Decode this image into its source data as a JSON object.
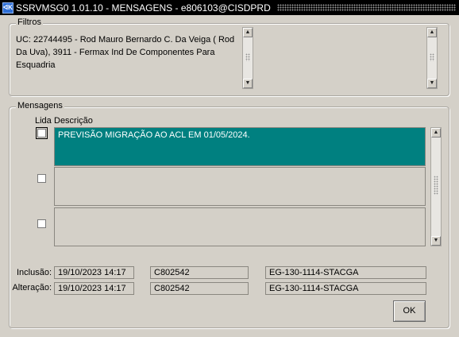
{
  "window": {
    "title": "SSRVMSG0 1.01.10 - MENSAGENS  - e806103@CISDPRD",
    "icon_name": "oracle-forms-icon",
    "icon_glyph": "ᐊK"
  },
  "filters": {
    "legend": "Filtros",
    "text": "UC: 22744495 - Rod Mauro Bernardo C. Da Veiga ( Rod Da Uva), 3911 - Fermax Ind De Componentes Para Esquadria"
  },
  "messages": {
    "legend": "Mensagens",
    "col_read": "Lida",
    "col_description": "Descrição",
    "rows": [
      {
        "read": false,
        "description": "PREVISÃO MIGRAÇÃO AO ACL EM 01/05/2024."
      },
      {
        "read": false,
        "description": ""
      },
      {
        "read": false,
        "description": ""
      }
    ]
  },
  "audit": {
    "inclusion_label": "Inclusão:",
    "inclusion_date": "19/10/2023 14:17",
    "inclusion_user": "C802542",
    "inclusion_host": "EG-130-1114-STACGA",
    "change_label": "Alteração:",
    "change_date": "19/10/2023 14:17",
    "change_user": "C802542",
    "change_host": "EG-130-1114-STACGA"
  },
  "buttons": {
    "ok_label": "OK"
  },
  "scroll": {
    "up_glyph": "▲",
    "down_glyph": "▼"
  }
}
